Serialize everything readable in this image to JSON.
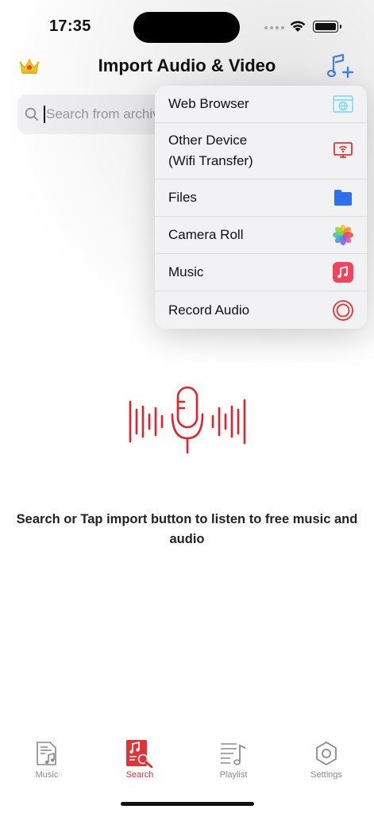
{
  "status": {
    "time": "17:35"
  },
  "nav": {
    "title": "Import Audio & Video"
  },
  "search": {
    "placeholder": "Search from archive"
  },
  "menu": {
    "items": [
      {
        "label": "Web Browser",
        "icon": "browser-icon"
      },
      {
        "label": "Other Device\n(Wifi Transfer)",
        "icon": "wifi-transfer-icon"
      },
      {
        "label": "Files",
        "icon": "files-folder-icon"
      },
      {
        "label": "Camera Roll",
        "icon": "photos-icon"
      },
      {
        "label": "Music",
        "icon": "apple-music-icon"
      },
      {
        "label": "Record Audio",
        "icon": "record-icon"
      }
    ]
  },
  "hint": {
    "text": "Search or Tap import button to listen to free music and audio"
  },
  "tabs": [
    {
      "label": "Music",
      "icon": "music-doc-icon"
    },
    {
      "label": "Search",
      "icon": "search-doc-icon"
    },
    {
      "label": "Playlist",
      "icon": "playlist-icon"
    },
    {
      "label": "Settings",
      "icon": "settings-icon"
    }
  ],
  "colors": {
    "accent": "#e03434",
    "menu_bg": "#f2f2f4",
    "import_icon": "#4a8df0"
  }
}
